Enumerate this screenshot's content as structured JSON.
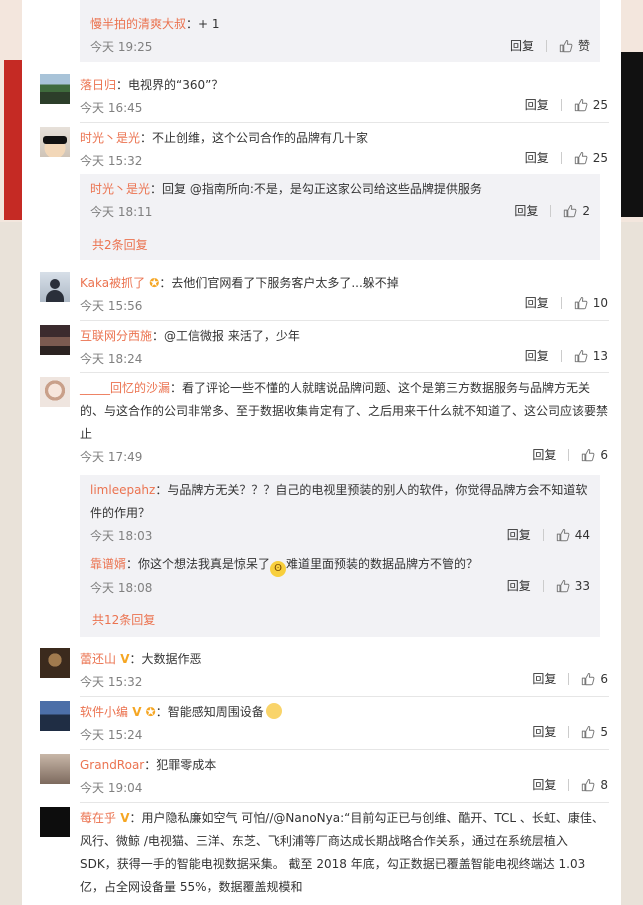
{
  "top_reply": {
    "user": "慢半拍的清爽大叔",
    "text": "：+ 1",
    "time": "今天 19:25",
    "reply_label": "回复",
    "like_label": "赞"
  },
  "comments": [
    {
      "user": "落日归",
      "text": "：电视界的“360”？",
      "time": "今天 16:45",
      "reply_label": "回复",
      "likes": "25"
    },
    {
      "user": "时光丶是光",
      "text": "：不止创维，这个公司合作的品牌有几十家",
      "time": "今天 15:32",
      "reply_label": "回复",
      "likes": "25"
    },
    {
      "user": "Kaka被抓了",
      "text": "：去他们官网看了下服务客户太多了...躲不掉",
      "time": "今天 15:56",
      "reply_label": "回复",
      "likes": "10"
    },
    {
      "user": "互联网分西施",
      "text": "：@工信微报 来活了，少年",
      "time": "今天 18:24",
      "reply_label": "回复",
      "likes": "13"
    },
    {
      "user": "_____回忆的沙漏",
      "text": "：看了评论一些不懂的人就瞎说品牌问题、这个是第三方数据服务与品牌方无关的、与这合作的公司非常多、至于数据收集肯定有了、之后用来干什么就不知道了、这公司应该要禁止",
      "time": "今天 17:49",
      "reply_label": "回复",
      "likes": "6"
    },
    {
      "user": "蕾还山",
      "text": "：大数据作恶",
      "time": "今天 15:32",
      "reply_label": "回复",
      "likes": "6"
    },
    {
      "user": "软件小编",
      "text": "：智能感知周围设备",
      "time": "今天 15:24",
      "reply_label": "回复",
      "likes": "5"
    },
    {
      "user": "GrandRoar",
      "text": "：犯罪零成本",
      "time": "今天 19:04",
      "reply_label": "回复",
      "likes": "8"
    },
    {
      "user": "莓在乎",
      "text": "：用户隐私廉如空气 可怕//@NanoNya:“目前勾正已与创维、酷开、TCL 、长虹、康佳、风行、微鲸 /电视猫、三洋、东芝、飞利浦等厂商达成长期战略合作关系，通过在系统层植入 SDK，获得一手的智能电视数据采集。 截至 2018 年底，勾正数据已覆盖智能电视终端达 1.03 亿，占全网设备量 55%，数据覆盖规模和"
    }
  ],
  "replies_a": [
    {
      "user": "时光丶是光",
      "text": "：回复 @指南所向:不是，是勾正这家公司给这些品牌提供服务",
      "time": "今天 18:11",
      "reply_label": "回复",
      "likes": "2"
    }
  ],
  "replies_a_more": "共2条回复",
  "replies_b": [
    {
      "user": "limleepahz",
      "text": "：与品牌方无关？？？自己的电视里预装的别人的软件，你觉得品牌方会不知道软件的作用？",
      "time": "今天 18:03",
      "reply_label": "回复",
      "likes": "44"
    },
    {
      "user": "靠谱婿",
      "text": "：你这个想法我真是惊呆了",
      "text2": "难道里面预装的数据品牌方不管的？",
      "time": "今天 18:08",
      "reply_label": "回复",
      "likes": "33"
    }
  ],
  "replies_b_more": "共12条回复",
  "colors": {
    "link": "#eb7350",
    "muted": "#808080",
    "reply_bg": "#f2f2f5"
  }
}
